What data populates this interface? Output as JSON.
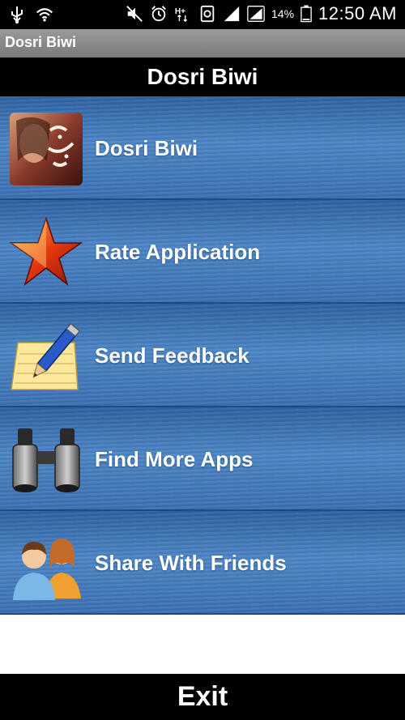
{
  "status_bar": {
    "battery_percent": "14%",
    "time": "12:50 AM",
    "icons": [
      "usb-icon",
      "wifi-icon",
      "mute-icon",
      "alarm-icon",
      "data-icon",
      "sync-icon",
      "signal-icon",
      "signal-icon-2",
      "battery-icon"
    ]
  },
  "app_title": "Dosri Biwi",
  "header": {
    "title": "Dosri Biwi"
  },
  "menu": [
    {
      "label": "Dosri Biwi",
      "icon": "book-cover-icon"
    },
    {
      "label": "Rate Application",
      "icon": "star-icon"
    },
    {
      "label": "Send Feedback",
      "icon": "notepad-pencil-icon"
    },
    {
      "label": "Find More Apps",
      "icon": "binoculars-icon"
    },
    {
      "label": "Share With Friends",
      "icon": "people-icon"
    }
  ],
  "footer": {
    "exit_label": "Exit"
  },
  "colors": {
    "menu_blue": "#3b70b2",
    "bar_black": "#000000"
  }
}
